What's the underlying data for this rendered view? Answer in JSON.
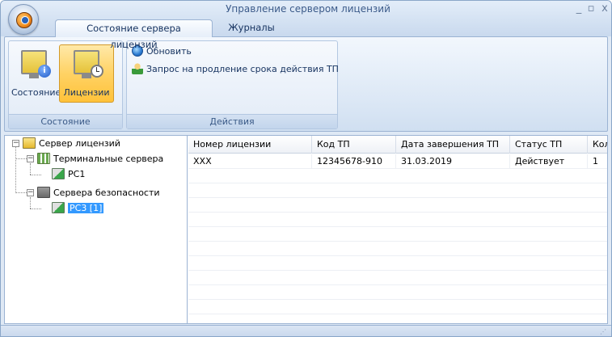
{
  "window": {
    "title": "Управление сервером лицензий"
  },
  "tabs": [
    {
      "label": "Состояние сервера лицензий",
      "active": true
    },
    {
      "label": "Журналы",
      "active": false
    }
  ],
  "ribbon": {
    "group_state": {
      "label": "Состояние",
      "buttons": [
        {
          "label": "Состояние",
          "icon": "monitor-info-icon"
        },
        {
          "label": "Лицензии",
          "icon": "monitor-clock-icon",
          "selected": true
        }
      ]
    },
    "group_actions": {
      "label": "Действия",
      "buttons": [
        {
          "label": "Обновить",
          "icon": "refresh-icon"
        },
        {
          "label": "Запрос на продление срока действия ТП",
          "icon": "user-request-icon"
        }
      ]
    }
  },
  "tree": {
    "root": "Сервер лицензий",
    "terminal": "Терминальные сервера",
    "terminal_child": "PC1",
    "security": "Сервера безопасности",
    "security_child": "PC3 [1]"
  },
  "grid": {
    "columns": [
      "Номер лицензии",
      "Код ТП",
      "Дата завершения ТП",
      "Статус ТП",
      "Кол"
    ],
    "rows": [
      [
        "XXX",
        "12345678-910",
        "31.03.2019",
        "Действует",
        "1"
      ]
    ]
  },
  "colors": {
    "accent": "#ffd264",
    "selection": "#3399ff",
    "chrome": "#dfe9f5"
  }
}
